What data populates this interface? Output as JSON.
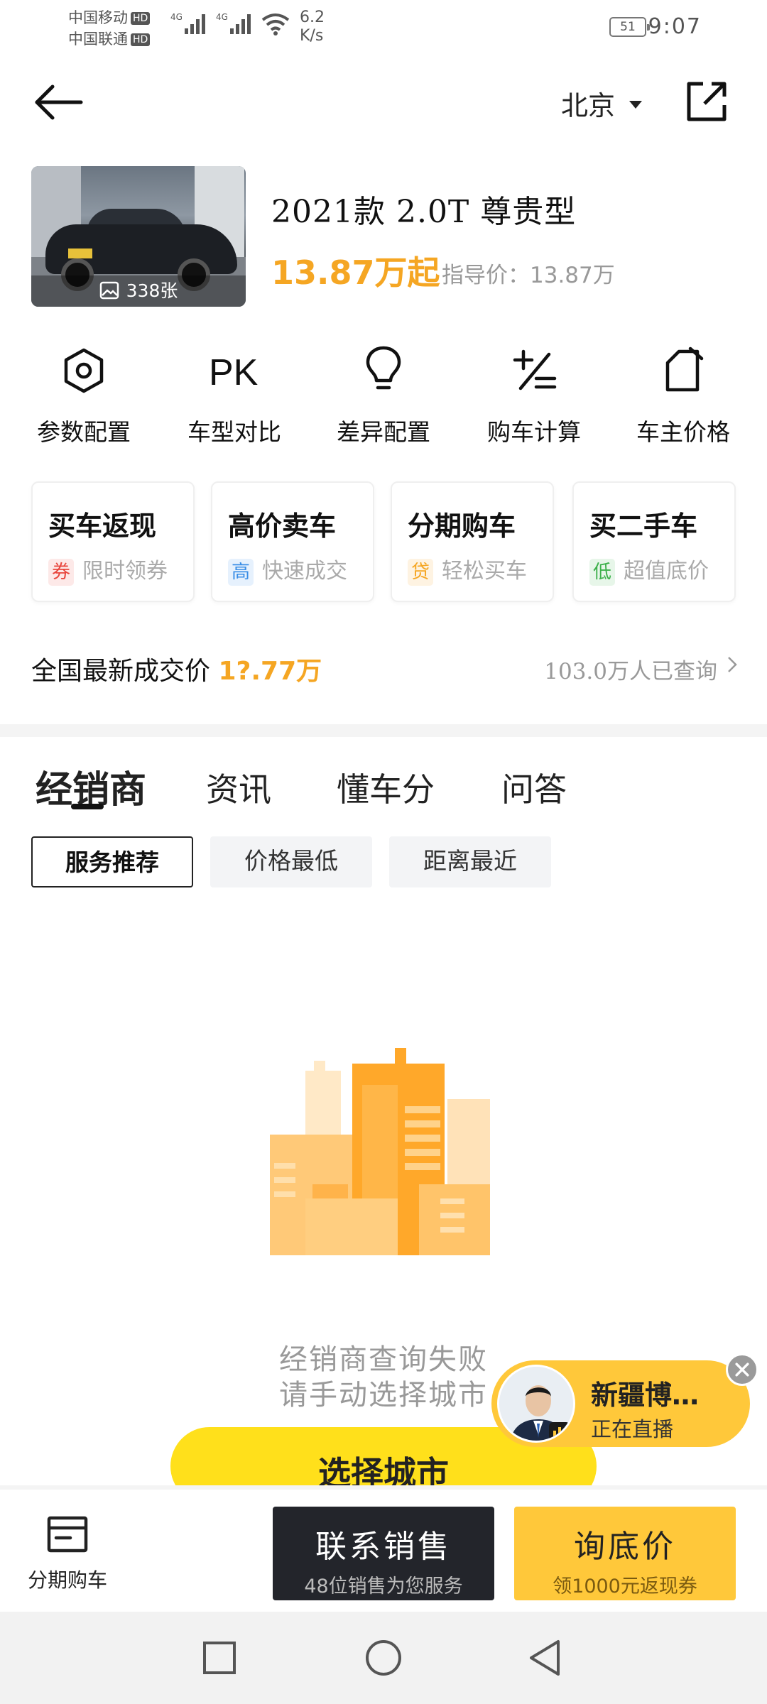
{
  "status_bar": {
    "carrier1": "中国移动",
    "carrier2": "中国联通",
    "hd": "HD",
    "net": "4G",
    "speed_value": "6.2",
    "speed_unit": "K/s",
    "battery": "51",
    "time": "9:07"
  },
  "header": {
    "city": "北京"
  },
  "car": {
    "photo_count": "338张",
    "title": "2021款 2.0T 尊贵型",
    "price": "13.87万起",
    "guide_price": "指导价：13.87万"
  },
  "quick_actions": [
    {
      "label": "参数配置",
      "icon": "hexagon-nut-icon"
    },
    {
      "label": "车型对比",
      "icon": "pk-icon"
    },
    {
      "label": "差异配置",
      "icon": "lightbulb-icon"
    },
    {
      "label": "购车计算",
      "icon": "calculator-icon"
    },
    {
      "label": "车主价格",
      "icon": "price-tag-icon"
    }
  ],
  "services": [
    {
      "title": "买车返现",
      "tag": "券",
      "sub": "限时领券",
      "tag_color": "#e8453c",
      "tag_bg": "#fde9e8"
    },
    {
      "title": "高价卖车",
      "tag": "高",
      "sub": "快速成交",
      "tag_color": "#3a8ee6",
      "tag_bg": "#e6f1fd"
    },
    {
      "title": "分期购车",
      "tag": "贷",
      "sub": "轻松买车",
      "tag_color": "#f5a623",
      "tag_bg": "#fef3e2"
    },
    {
      "title": "买二手车",
      "tag": "低",
      "sub": "超值底价",
      "tag_color": "#3cb04a",
      "tag_bg": "#e7f6e9"
    }
  ],
  "latest_price": {
    "label": "全国最新成交价 ",
    "value": "1?.77万",
    "count": "103.0万人已查询"
  },
  "tabs": [
    "经销商",
    "资讯",
    "懂车分",
    "问答"
  ],
  "filters": [
    "服务推荐",
    "价格最低",
    "距离最近"
  ],
  "empty_state": {
    "line1": "经销商查询失败",
    "line2": "请手动选择城市",
    "button": "选择城市"
  },
  "live": {
    "name": "新疆博…",
    "status": "正在直播"
  },
  "bottom_bar": {
    "installment": "分期购车",
    "contact_title": "联系销售",
    "contact_sub": "48位销售为您服务",
    "price_title": "询底价",
    "price_sub": "领1000元返现券"
  },
  "colors": {
    "accent_orange": "#f5a623",
    "accent_yellow": "#ffe01b",
    "dark_button": "#23252b"
  }
}
